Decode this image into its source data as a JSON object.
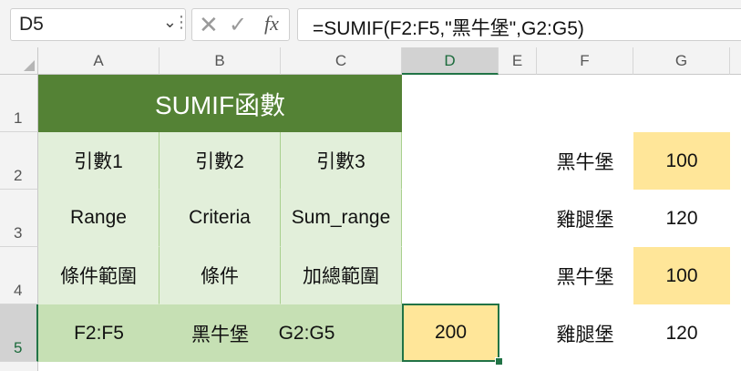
{
  "formula_bar": {
    "name_box": "D5",
    "cancel_icon": "✕",
    "enter_icon": "✓",
    "fx_label": "fx",
    "formula": "=SUMIF(F2:F5,\"黑牛堡\",G2:G5)"
  },
  "columns": [
    "A",
    "B",
    "C",
    "D",
    "E",
    "F",
    "G"
  ],
  "rows": [
    "1",
    "2",
    "3",
    "4",
    "5"
  ],
  "selected_cell": "D5",
  "table": {
    "title": "SUMIF函數",
    "headers": [
      "引數1",
      "引數2",
      "引數3"
    ],
    "english": [
      "Range",
      "Criteria",
      "Sum_range"
    ],
    "chinese": [
      "條件範圍",
      "條件",
      "加總範圍"
    ],
    "values": [
      "F2:F5",
      "黑牛堡",
      "G2:G5"
    ]
  },
  "result": "200",
  "data_list": [
    {
      "name": "黑牛堡",
      "value": "100"
    },
    {
      "name": "雞腿堡",
      "value": "120"
    },
    {
      "name": "黑牛堡",
      "value": "100"
    },
    {
      "name": "雞腿堡",
      "value": "120"
    }
  ],
  "colors": {
    "title_bg": "#548235",
    "table_bg": "#e2efda",
    "row5_bg": "#c6e0b4",
    "highlight": "#ffe699",
    "selection": "#217346"
  }
}
